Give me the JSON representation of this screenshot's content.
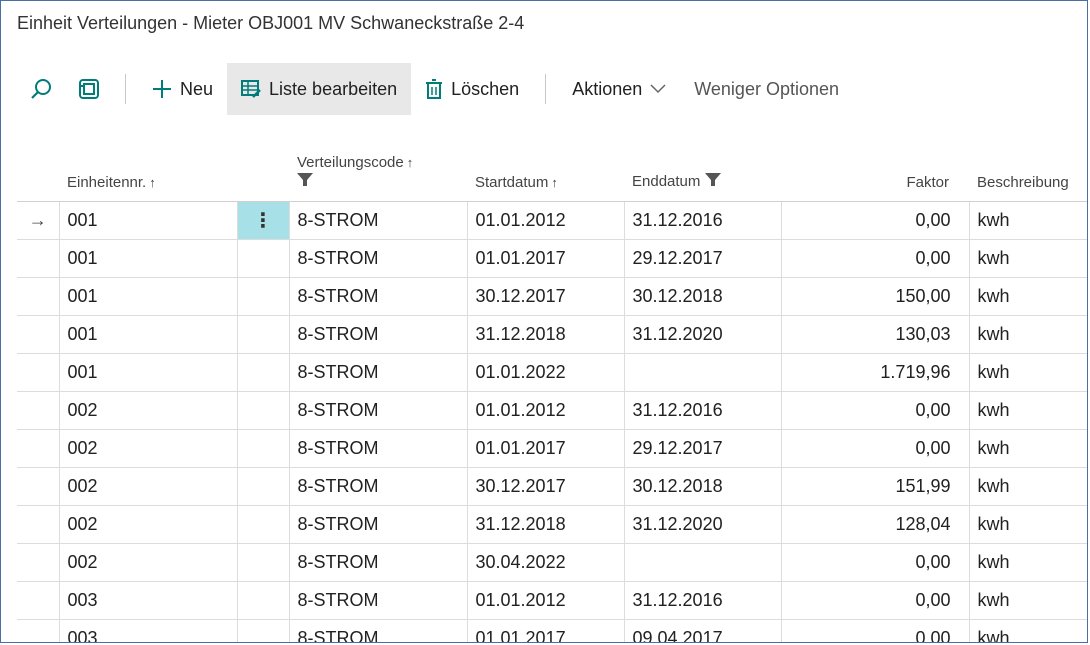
{
  "window": {
    "title": "Einheit Verteilungen - Mieter OBJ001 MV Schwaneckstraße 2-4"
  },
  "toolbar": {
    "new_label": "Neu",
    "edit_list_label": "Liste bearbeiten",
    "delete_label": "Löschen",
    "actions_label": "Aktionen",
    "fewer_options_label": "Weniger Optionen"
  },
  "columns": {
    "unit_no": "Einheitennr.",
    "dist_code": "Verteilungscode",
    "start_date": "Startdatum",
    "end_date": "Enddatum",
    "factor": "Faktor",
    "description": "Beschreibung"
  },
  "sort_glyph": "↑",
  "row_indicator": "→",
  "row_menu_glyph": "⋮",
  "rows": [
    {
      "unit": "001",
      "code": "8-STROM",
      "start": "01.01.2012",
      "end": "31.12.2016",
      "factor": "0,00",
      "desc": "kwh"
    },
    {
      "unit": "001",
      "code": "8-STROM",
      "start": "01.01.2017",
      "end": "29.12.2017",
      "factor": "0,00",
      "desc": "kwh"
    },
    {
      "unit": "001",
      "code": "8-STROM",
      "start": "30.12.2017",
      "end": "30.12.2018",
      "factor": "150,00",
      "desc": "kwh"
    },
    {
      "unit": "001",
      "code": "8-STROM",
      "start": "31.12.2018",
      "end": "31.12.2020",
      "factor": "130,03",
      "desc": "kwh"
    },
    {
      "unit": "001",
      "code": "8-STROM",
      "start": "01.01.2022",
      "end": "",
      "factor": "1.719,96",
      "desc": "kwh"
    },
    {
      "unit": "002",
      "code": "8-STROM",
      "start": "01.01.2012",
      "end": "31.12.2016",
      "factor": "0,00",
      "desc": "kwh"
    },
    {
      "unit": "002",
      "code": "8-STROM",
      "start": "01.01.2017",
      "end": "29.12.2017",
      "factor": "0,00",
      "desc": "kwh"
    },
    {
      "unit": "002",
      "code": "8-STROM",
      "start": "30.12.2017",
      "end": "30.12.2018",
      "factor": "151,99",
      "desc": "kwh"
    },
    {
      "unit": "002",
      "code": "8-STROM",
      "start": "31.12.2018",
      "end": "31.12.2020",
      "factor": "128,04",
      "desc": "kwh"
    },
    {
      "unit": "002",
      "code": "8-STROM",
      "start": "30.04.2022",
      "end": "",
      "factor": "0,00",
      "desc": "kwh"
    },
    {
      "unit": "003",
      "code": "8-STROM",
      "start": "01.01.2012",
      "end": "31.12.2016",
      "factor": "0,00",
      "desc": "kwh"
    },
    {
      "unit": "003",
      "code": "8-STROM",
      "start": "01.01.2017",
      "end": "09.04.2017",
      "factor": "0,00",
      "desc": "kwh"
    }
  ]
}
